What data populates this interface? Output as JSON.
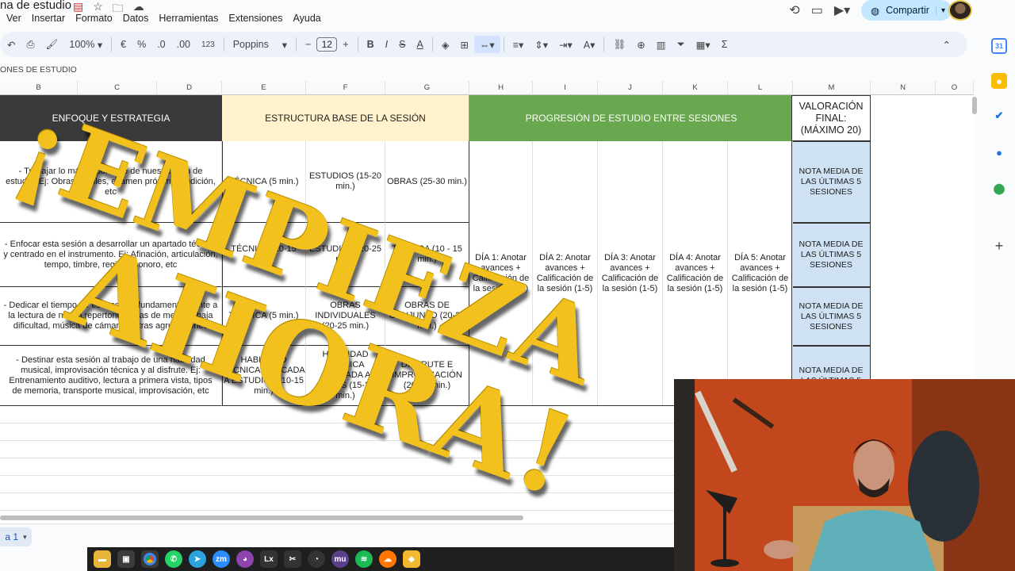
{
  "header": {
    "doc_title": "na de estudio",
    "menu": [
      "Ver",
      "Insertar",
      "Formato",
      "Datos",
      "Herramientas",
      "Extensiones",
      "Ayuda"
    ],
    "share_label": "Compartir"
  },
  "toolbar": {
    "zoom": "100%",
    "currency": "€",
    "percent": "%",
    "dec_less": ".0",
    "dec_more": ".00",
    "num_format": "123",
    "font_name": "Poppins",
    "font_size": "12"
  },
  "namebox": "ONES DE ESTUDIO",
  "columns": [
    "B",
    "C",
    "D",
    "E",
    "F",
    "G",
    "H",
    "I",
    "J",
    "K",
    "L",
    "M",
    "N",
    "O"
  ],
  "bands": {
    "enfoque": "ENFOQUE Y ESTRATEGIA",
    "estructura": "ESTRUCTURA BASE DE LA SESIÓN",
    "progresion": "PROGRESIÓN DE ESTUDIO ENTRE SESIONES",
    "valoracion": "VALORACIÓN FINAL: (MÁXIMO 20)"
  },
  "rows": [
    {
      "enfoque": "- Trabajar lo más importante de nuestro plan de estudio. Ej: Obras difíciles, examen próximo, audición, etc",
      "e": "TÉCNICA (5 min.)",
      "f": "ESTUDIOS (15-20 min.)",
      "g": "OBRAS (25-30 min.)",
      "nota": "NOTA MEDIA DE LAS ÚLTIMAS 5 SESIONES"
    },
    {
      "enfoque": "- Enfocar esta sesión a desarrollar un apartado técnico y centrado en el instrumento. Ej: Afinación, articulación, tempo, timbre, registro sonoro, etc",
      "e": "TÉCNICA (10-15 min.)",
      "f": "ESTUDIOS (20-25 min.)",
      "g": "TÉCNICA (10 - 15 min.)",
      "nota": "NOTA MEDIA DE LAS ÚLTIMAS 5 SESIONES"
    },
    {
      "enfoque": "- Dedicar el tiempo de esta sesión fundamentalmente a la lectura de nuevo repertorio, obras de media o baja dificultad, música de cámara u otras agrupaciones",
      "e": "TÉCNICA (5 min.)",
      "f": "OBRAS INDIVIDUALES (20-25 min.)",
      "g": "OBRAS DE CONJUNTO (20-25 min.)",
      "nota": "NOTA MEDIA DE LAS ÚLTIMAS 5 SESIONES"
    },
    {
      "enfoque": "- Destinar esta sesión al trabajo de una habilidad musical, improvisación técnica y al disfrute. Ej: Entrenamiento auditivo, lectura a primera vista, tipos de memoria, transporte musical, improvisación, etc",
      "e": "HABILIDAD TÉCNICA APLICADA A ESTUDIOS (10-15 min.)",
      "f": "HABILIDAD TÉCNICA APLICADA A OBRAS (15-20 min.)",
      "g": "DISFRUTE E IMPROVISACIÓN (20-25 min.)",
      "nota": "NOTA MEDIA DE LAS ÚLTIMAS 5"
    }
  ],
  "dias": [
    "DÍA 1: Anotar avances + Calificación de la sesión (1-5)",
    "DÍA 2: Anotar avances + Calificación de la sesión (1-5)",
    "DÍA 3: Anotar avances + Calificación de la sesión (1-5)",
    "DÍA 4: Anotar avances + Calificación de la sesión (1-5)",
    "DÍA 5: Anotar avances + Calificación de la sesión (1-5)"
  ],
  "overlay": {
    "line1": "¡EMPIEZA",
    "line2": "AHORA!"
  },
  "sheet_tab": "a 1",
  "colors": {
    "accent_green": "#6aa84f",
    "header_yellow": "#fff2cc",
    "nota_blue": "#cfe2f3",
    "headline_gold": "#f2c11d"
  }
}
